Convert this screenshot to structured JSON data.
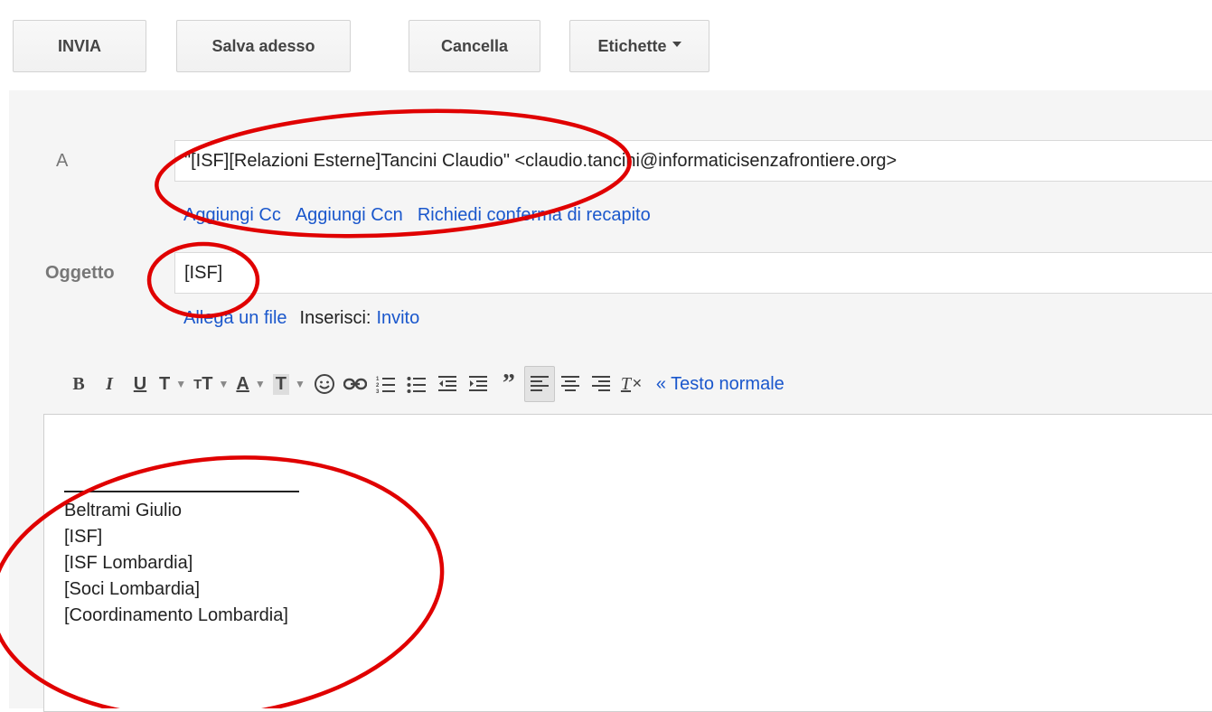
{
  "toolbar": {
    "send_label": "INVIA",
    "save_label": "Salva adesso",
    "discard_label": "Cancella",
    "labels_label": "Etichette"
  },
  "compose": {
    "to_label": "A",
    "to_value": "\"[ISF][Relazioni Esterne]Tancini Claudio\" <claudio.tancini@informaticisenzafrontiere.org>",
    "links": {
      "cc": "Aggiungi Cc",
      "bcc": "Aggiungi Ccn",
      "receipt": "Richiedi conferma di recapito"
    },
    "subject_label": "Oggetto",
    "subject_value": "[ISF]",
    "attach_label": "Allega un file",
    "insert_label": "Inserisci:",
    "insert_link": "Invito"
  },
  "format_toolbar": {
    "items": [
      "bold-icon",
      "italic-icon",
      "underline-icon",
      "font-icon",
      "font-size-icon",
      "text-color-icon",
      "highlight-icon",
      "emoji-icon",
      "link-icon",
      "numbered-list-icon",
      "bulleted-list-icon",
      "indent-less-icon",
      "indent-more-icon",
      "quote-icon",
      "align-left-icon",
      "align-center-icon",
      "align-right-icon",
      "clear-formatting-icon"
    ],
    "plain_text_link": "« Testo normale"
  },
  "body": {
    "signature_lines": [
      "Beltrami Giulio",
      "[ISF]",
      "[ISF Lombardia]",
      "[Soci Lombardia]",
      "[Coordinamento Lombardia]"
    ]
  },
  "colors": {
    "annotation": "#e00000",
    "link": "#1a57cc"
  }
}
